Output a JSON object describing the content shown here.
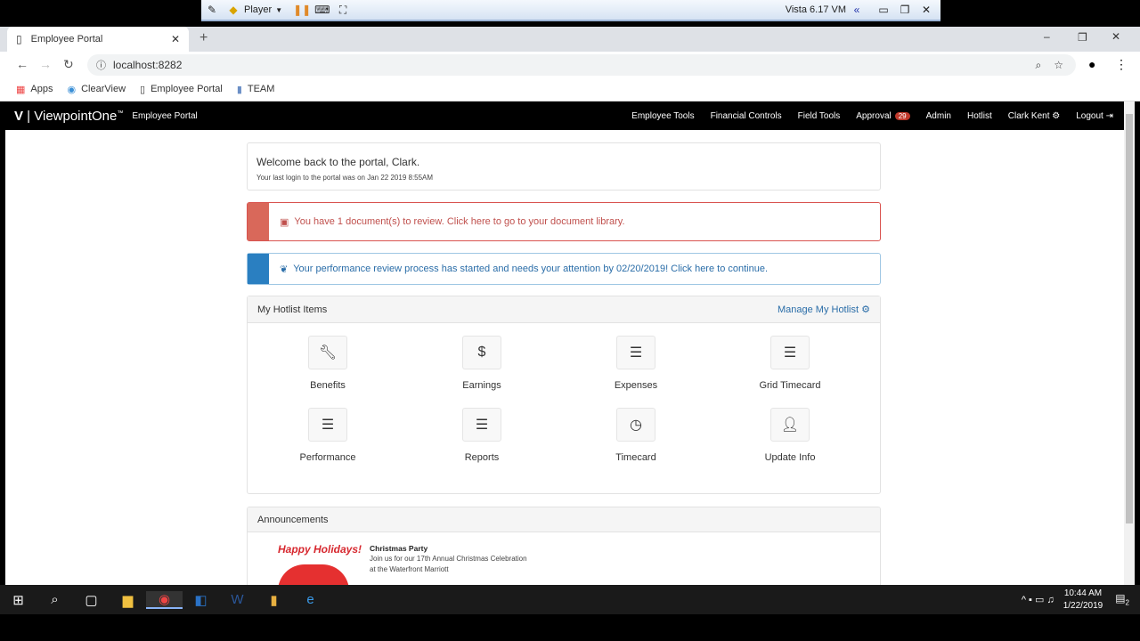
{
  "vm": {
    "player_label": "Player",
    "vm_name": "Vista 6.17 VM"
  },
  "browser": {
    "tab_title": "Employee Portal",
    "url": "localhost:8282",
    "bookmarks": [
      "Apps",
      "ClearView",
      "Employee Portal",
      "TEAM"
    ]
  },
  "nav": {
    "brand": "ViewpointOne",
    "trademark": "™",
    "subtitle": "Employee Portal",
    "items": [
      "Employee Tools",
      "Financial Controls",
      "Field Tools",
      "Approval",
      "Admin",
      "Hotlist",
      "Clark Kent",
      "Logout"
    ],
    "approval_count": "29"
  },
  "welcome": {
    "title": "Welcome back to the portal, Clark.",
    "last_login": "Your last login to the portal was on Jan 22 2019 8:55AM"
  },
  "alerts": {
    "documents": "You have 1 document(s) to review. Click here to go to your document library.",
    "performance": "Your performance review process has started and needs your attention by 02/20/2019! Click here to continue."
  },
  "colors": {
    "danger": "#d9534f",
    "info": "#2a7fc1",
    "nav": "#000000"
  },
  "hotlist": {
    "title": "My Hotlist Items",
    "manage": "Manage My Hotlist",
    "items": [
      {
        "label": "Benefits",
        "icon": "wrench-icon"
      },
      {
        "label": "Earnings",
        "icon": "dollar-icon"
      },
      {
        "label": "Expenses",
        "icon": "server-icon"
      },
      {
        "label": "Grid Timecard",
        "icon": "server-icon"
      },
      {
        "label": "Performance",
        "icon": "server-icon"
      },
      {
        "label": "Reports",
        "icon": "server-icon"
      },
      {
        "label": "Timecard",
        "icon": "clock-icon"
      },
      {
        "label": "Update Info",
        "icon": "user-icon"
      }
    ]
  },
  "announcements": {
    "title": "Announcements",
    "image_text": "Happy Holidays!",
    "item_title": "Christmas Party",
    "item_body_1": "Join us for our 17th Annual Christmas Celebration",
    "item_body_2": "at the Waterfront Marriott"
  },
  "taskbar": {
    "time": "10:44 AM",
    "date": "1/22/2019",
    "notifications": "2"
  }
}
